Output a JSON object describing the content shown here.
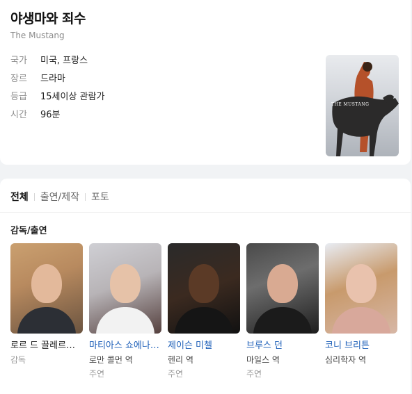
{
  "movie": {
    "title": "야생마와 죄수",
    "original_title": "The Mustang",
    "info": [
      {
        "key": "국가",
        "value": "미국, 프랑스"
      },
      {
        "key": "장르",
        "value": "드라마"
      },
      {
        "key": "등급",
        "value": "15세이상 관람가"
      },
      {
        "key": "시간",
        "value": "96분"
      }
    ],
    "poster_text": "THE MUSTANG"
  },
  "tabs": [
    {
      "label": "전체",
      "active": true
    },
    {
      "label": "출연/제작",
      "active": false
    },
    {
      "label": "포토",
      "active": false
    }
  ],
  "section_title": "감독/출연",
  "people": [
    {
      "name": "로르 드 끌레르몽 토네르",
      "role": "감독",
      "sub": ""
    },
    {
      "name": "마티아스 쇼에나에츠",
      "role": "로만 콜먼 역",
      "sub": "주연"
    },
    {
      "name": "제이슨 미첼",
      "role": "헨리 역",
      "sub": "주연"
    },
    {
      "name": "브루스 던",
      "role": "마일스 역",
      "sub": "주연"
    },
    {
      "name": "코니 브리튼",
      "role": "심리학자 역",
      "sub": ""
    }
  ]
}
